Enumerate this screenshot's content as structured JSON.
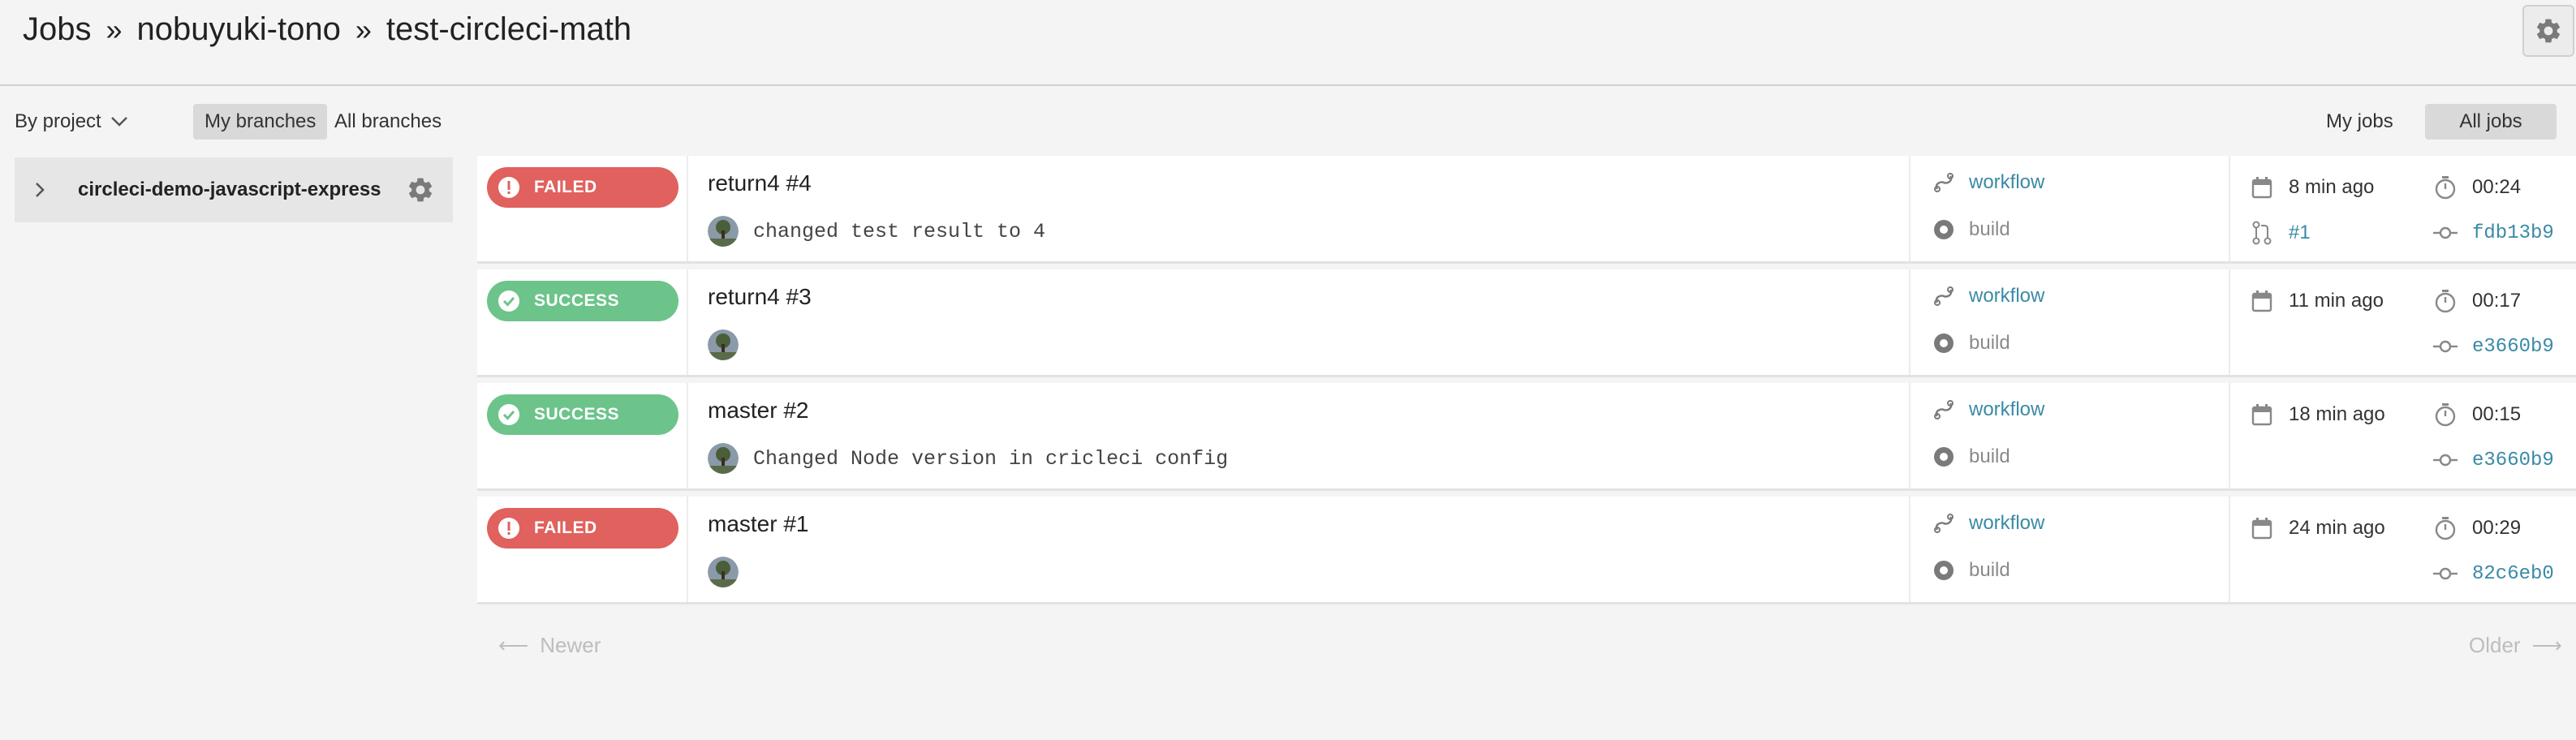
{
  "breadcrumb": {
    "root": "Jobs",
    "org": "nobuyuki-tono",
    "repo": "test-circleci-math",
    "separator": "»"
  },
  "filters": {
    "by_project": "By project",
    "my_branches": "My branches",
    "all_branches": "All branches",
    "my_jobs": "My jobs",
    "all_jobs": "All jobs"
  },
  "sidebar": {
    "project_name": "circleci-demo-javascript-express"
  },
  "jobs": [
    {
      "status": "FAILED",
      "title": "return4 #4",
      "commit_message": "changed test result to 4",
      "workflow": "workflow",
      "job": "build",
      "time_ago": "8 min ago",
      "duration": "00:24",
      "pr": "#1",
      "sha": "fdb13b9"
    },
    {
      "status": "SUCCESS",
      "title": "return4 #3",
      "commit_message": "",
      "workflow": "workflow",
      "job": "build",
      "time_ago": "11 min ago",
      "duration": "00:17",
      "sha": "e3660b9"
    },
    {
      "status": "SUCCESS",
      "title": "master #2",
      "commit_message": "Changed Node version in cricleci config",
      "workflow": "workflow",
      "job": "build",
      "time_ago": "18 min ago",
      "duration": "00:15",
      "sha": "e3660b9"
    },
    {
      "status": "FAILED",
      "title": "master #1",
      "commit_message": "",
      "workflow": "workflow",
      "job": "build",
      "time_ago": "24 min ago",
      "duration": "00:29",
      "sha": "82c6eb0"
    }
  ],
  "pagination": {
    "newer": "Newer",
    "older": "Older",
    "newer_arrow": "⟵",
    "older_arrow": "⟶"
  },
  "colors": {
    "failed": "#e0615d",
    "success": "#6cc48a",
    "link": "#3a8aa6"
  }
}
